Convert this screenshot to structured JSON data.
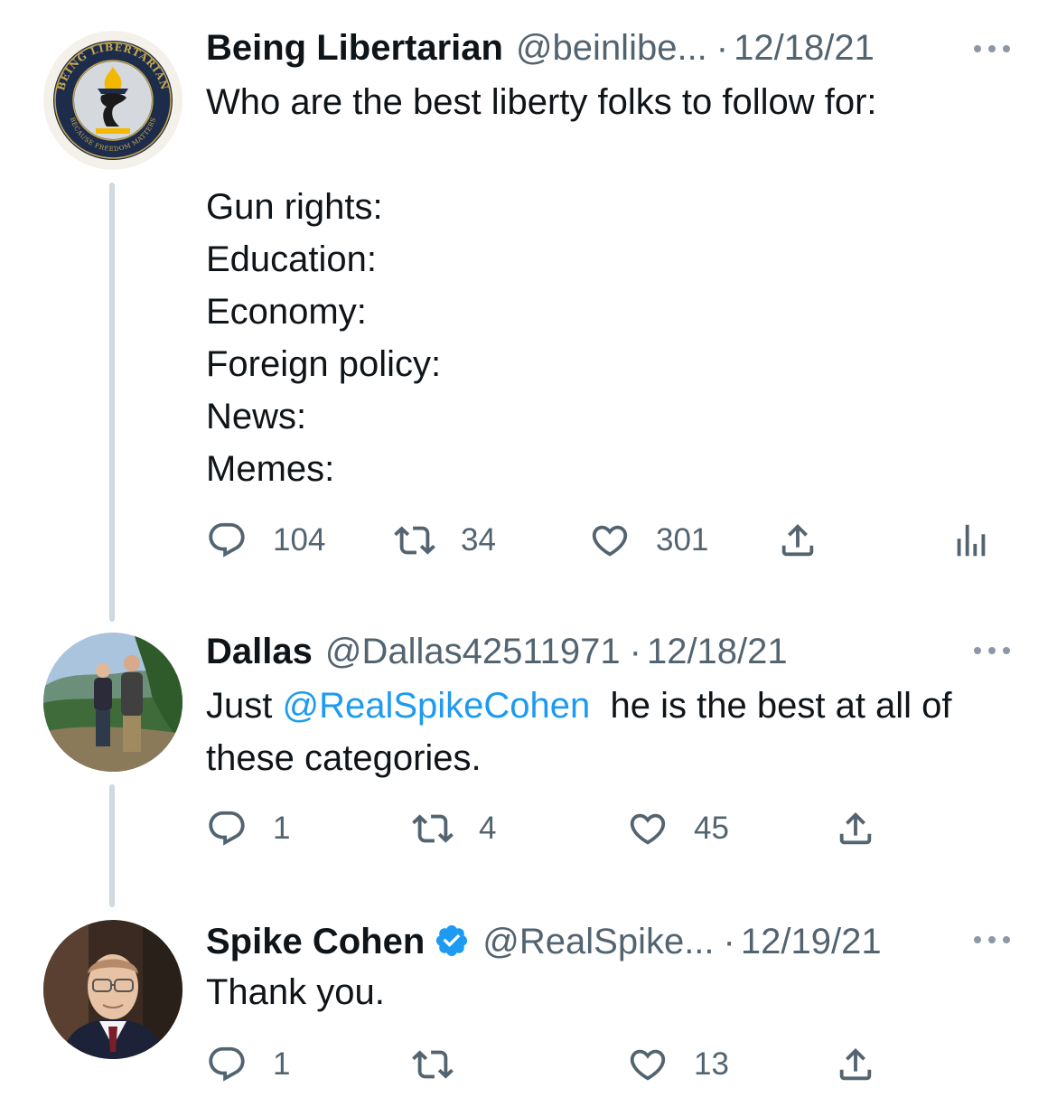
{
  "tweets": [
    {
      "name": "Being Libertarian",
      "handle": "@beinlibe...",
      "date": "12/18/21",
      "avatar_icon": "being-libertarian-logo",
      "avatar_text": {
        "top": "BEING LIBERTARIAN",
        "bottom": "BECAUSE FREEDOM MATTERS"
      },
      "text": "Who are the best liberty folks to follow for:\n\nGun rights:\nEducation:\nEconomy:\nForeign policy:\nNews:\nMemes:",
      "replies": "104",
      "retweets": "34",
      "likes": "301"
    },
    {
      "name": "Dallas",
      "handle": "@Dallas42511971",
      "date": "12/18/21",
      "avatar_icon": "photo-two-people-outdoors",
      "text_prefix": "Just ",
      "mention": "@RealSpikeCohen",
      "text_suffix": "  he is the best at all of these categories.",
      "replies": "1",
      "retweets": "4",
      "likes": "45"
    },
    {
      "name": "Spike Cohen",
      "verified": true,
      "handle": "@RealSpike...",
      "date": "12/19/21",
      "avatar_icon": "photo-man-glasses-suit",
      "text": "Thank you.",
      "replies": "1",
      "retweets": "",
      "likes": "13"
    }
  ],
  "separator": "·",
  "colors": {
    "text": "#0f1419",
    "secondary": "#536471",
    "link": "#1d9bf0",
    "thread_line": "#cfd9de",
    "verified": "#1d9bf0"
  },
  "icons": [
    "reply-icon",
    "retweet-icon",
    "like-icon",
    "share-icon",
    "analytics-icon",
    "more-icon",
    "verified-badge-icon"
  ]
}
